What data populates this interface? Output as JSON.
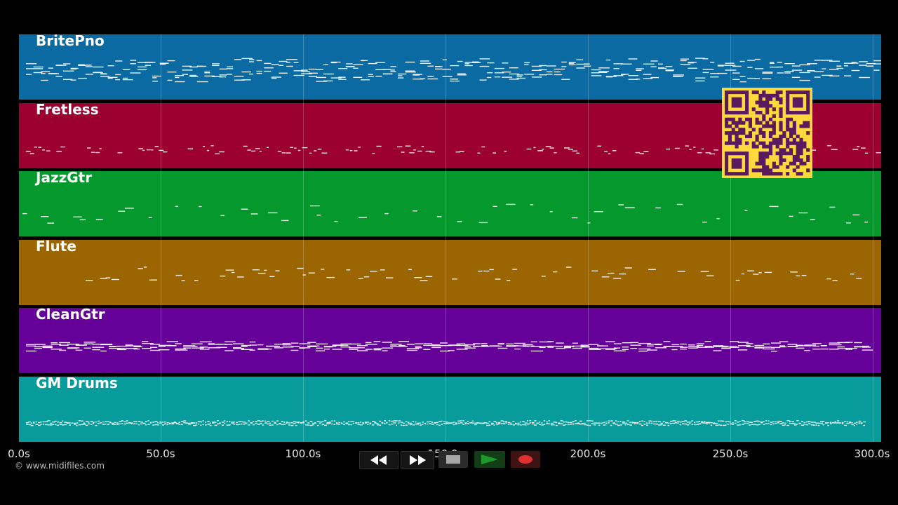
{
  "tracks": [
    {
      "name": "BritePno",
      "color": "#0a6aa1"
    },
    {
      "name": "Fretless",
      "color": "#9b0030"
    },
    {
      "name": "JazzGtr",
      "color": "#05982d"
    },
    {
      "name": "Flute",
      "color": "#9b6502"
    },
    {
      "name": "CleanGtr",
      "color": "#650099"
    },
    {
      "name": "GM Drums",
      "color": "#089b9b"
    }
  ],
  "timeline": {
    "ticks": [
      "0.0s",
      "50.0s",
      "100.0s",
      "150.0s",
      "200.0s",
      "250.0s",
      "300.0s"
    ]
  },
  "copyright": "© www.midifiles.com",
  "transport": {
    "rewind": "rewind-icon",
    "fast_forward": "fast-forward-icon",
    "stop": "stop-icon",
    "play": "play-icon",
    "record": "record-icon",
    "play_color": "#1e9a2a",
    "record_color": "#e03131"
  },
  "qr_color": "#ffd83b"
}
